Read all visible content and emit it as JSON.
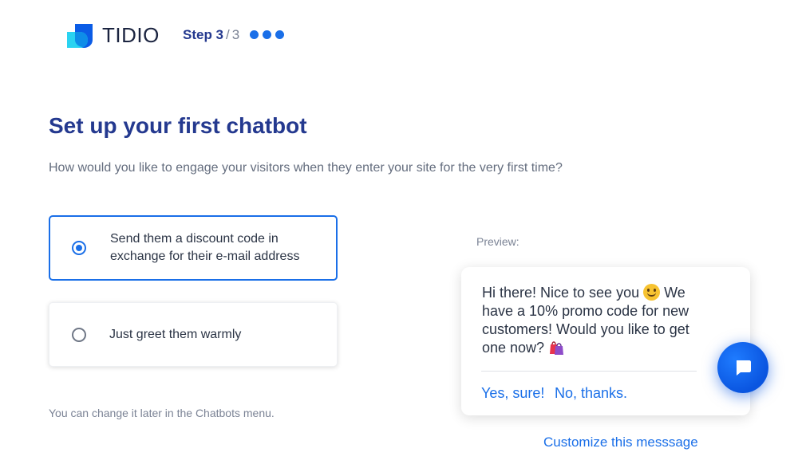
{
  "header": {
    "logo_text": "TIDIO",
    "step_label": "Step 3",
    "step_separator": "/",
    "step_total": "3"
  },
  "main": {
    "title": "Set up your first chatbot",
    "subtitle": "How would you like to engage your visitors when they enter your site for the very first time?",
    "options": [
      {
        "label": "Send them a discount code in exchange for their e-mail address",
        "selected": true
      },
      {
        "label": "Just greet them warmly",
        "selected": false
      }
    ],
    "note": "You can change it later in the Chatbots menu."
  },
  "preview": {
    "label": "Preview:",
    "message_part1": "Hi there! Nice to see you",
    "message_part2": "We have a 10% promo code for new customers! Would you like to get one now?",
    "reply_yes": "Yes, sure!",
    "reply_no": "No, thanks.",
    "customize_link": "Customize this messsage"
  },
  "icons": {
    "logo": "tidio-logo-icon",
    "chat_launcher": "chat-bubble-icon",
    "smile_emoji": "slightly-smiling-face-emoji",
    "bag_emoji": "shopping-bags-emoji"
  },
  "colors": {
    "brand_blue": "#1a6fe8",
    "title_navy": "#24398f",
    "muted_text": "#646d7e"
  }
}
